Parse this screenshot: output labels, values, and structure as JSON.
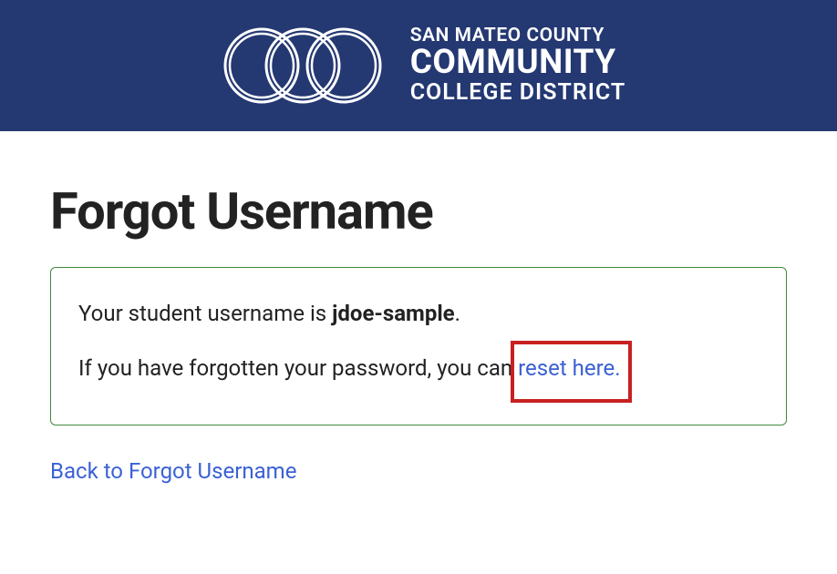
{
  "header": {
    "line1": "SAN MATEO COUNTY",
    "line2": "COMMUNITY",
    "line3": "COLLEGE DISTRICT"
  },
  "page": {
    "title": "Forgot Username"
  },
  "panel": {
    "line1_prefix": "Your student username is ",
    "username": "jdoe-sample",
    "line1_suffix": ".",
    "line2_prefix": "If you have forgotten your password, you can ",
    "reset_link_text": "reset here."
  },
  "links": {
    "back_text": "Back to Forgot Username"
  }
}
